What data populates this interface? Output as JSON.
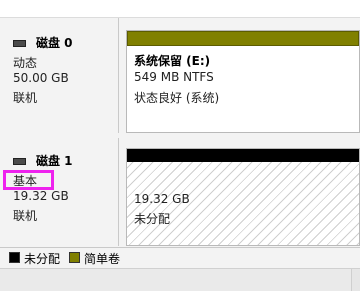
{
  "disks": [
    {
      "name": "磁盘 0",
      "type": "动态",
      "size": "50.00 GB",
      "status": "联机",
      "volume": {
        "label": "系统保留  (E:)",
        "size_fs": "549 MB NTFS",
        "status": "状态良好 (系统)",
        "bar_color": "#808000"
      }
    },
    {
      "name": "磁盘 1",
      "type": "基本",
      "size": "19.32 GB",
      "status": "联机",
      "volume": {
        "size": "19.32 GB",
        "status": "未分配",
        "bar_color": "#000000"
      }
    }
  ],
  "legend": [
    {
      "label": "未分配",
      "color": "#000000"
    },
    {
      "label": "简单卷",
      "color": "#808000"
    }
  ],
  "highlight_color": "#ee22ee"
}
